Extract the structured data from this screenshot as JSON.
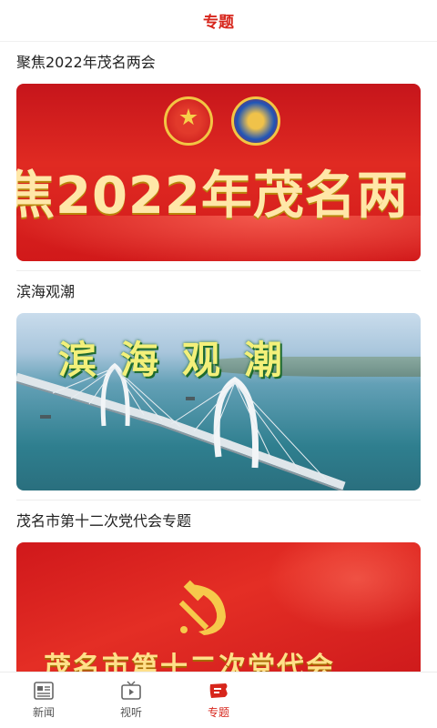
{
  "header": {
    "title": "专题"
  },
  "topics": [
    {
      "title": "聚焦2022年茂名两会",
      "banner_text": "焦2022年茂名两"
    },
    {
      "title": "滨海观潮",
      "banner_text": "滨海观潮"
    },
    {
      "title": "茂名市第十二次党代会专题",
      "banner_text": "茂名市第十二次党代会"
    }
  ],
  "tabs": [
    {
      "label": "新闻",
      "icon": "newspaper-icon"
    },
    {
      "label": "视听",
      "icon": "tv-icon"
    },
    {
      "label": "专题",
      "icon": "topic-icon",
      "active": true
    }
  ],
  "colors": {
    "accent": "#d7261c",
    "banner_red": "#d1191a",
    "gold": "#ffe7a8"
  }
}
